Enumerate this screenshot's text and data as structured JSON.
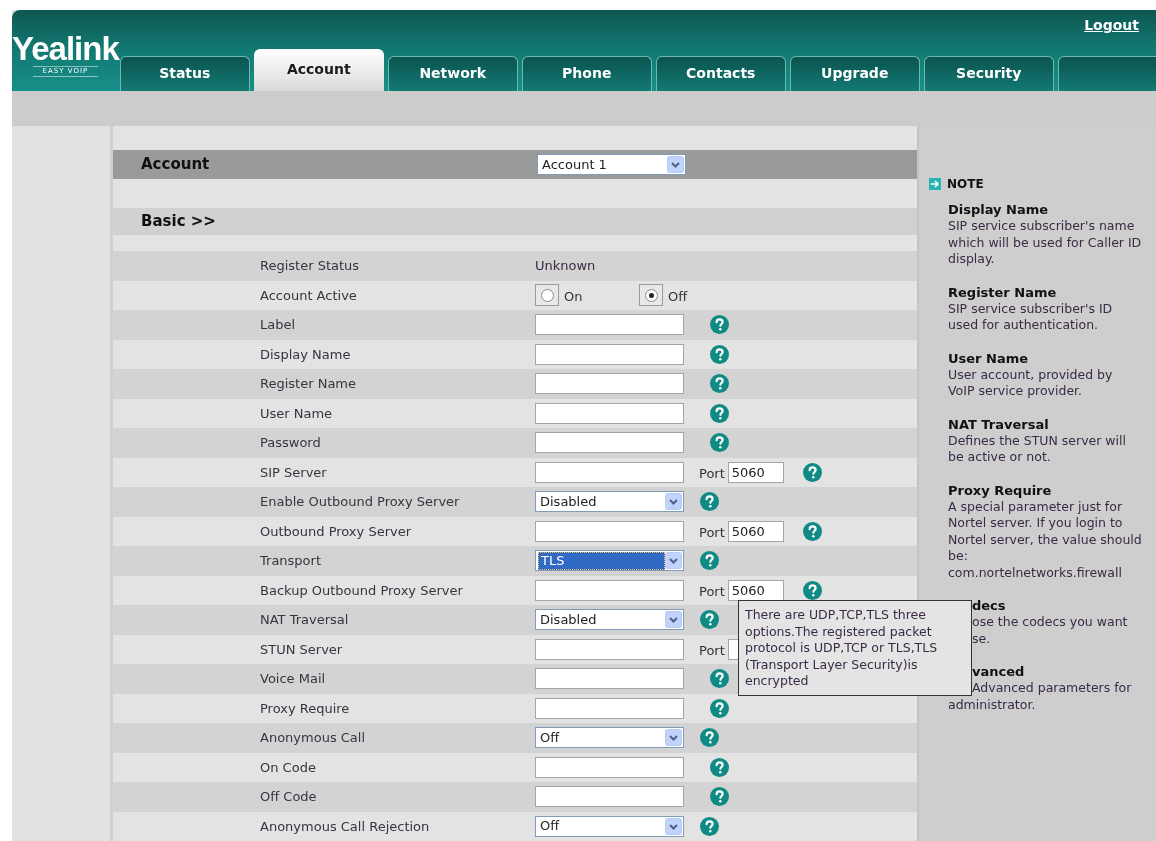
{
  "header": {
    "logo": "Yealink",
    "tagline": "EASY VOIP",
    "logout": "Logout"
  },
  "tabs": [
    {
      "label": "Status",
      "selected": false
    },
    {
      "label": "Account",
      "selected": true
    },
    {
      "label": "Network",
      "selected": false
    },
    {
      "label": "Phone",
      "selected": false
    },
    {
      "label": "Contacts",
      "selected": false
    },
    {
      "label": "Upgrade",
      "selected": false
    },
    {
      "label": "Security",
      "selected": false
    },
    {
      "selected": false
    }
  ],
  "account_bar": {
    "title": "Account",
    "select": "Account 1"
  },
  "section": {
    "title": "Basic >>"
  },
  "rows": [
    {
      "kind": "text",
      "label": "Register Status",
      "value": "Unknown",
      "help": false
    },
    {
      "kind": "radio",
      "label": "Account Active",
      "options": [
        {
          "label": "On",
          "selected": false
        },
        {
          "label": "Off",
          "selected": true
        }
      ],
      "help": false
    },
    {
      "kind": "input",
      "label": "Label",
      "value": "",
      "help": true
    },
    {
      "kind": "input",
      "label": "Display Name",
      "value": "",
      "help": true
    },
    {
      "kind": "input",
      "label": "Register Name",
      "value": "",
      "help": true
    },
    {
      "kind": "input",
      "label": "User Name",
      "value": "",
      "help": true
    },
    {
      "kind": "input",
      "label": "Password",
      "value": "",
      "help": true
    },
    {
      "kind": "port",
      "label": "SIP Server",
      "value": "",
      "port_label": "Port",
      "port": "5060",
      "help": true
    },
    {
      "kind": "select",
      "label": "Enable Outbound Proxy Server",
      "value": "Disabled",
      "highlighted": false,
      "help": true
    },
    {
      "kind": "port",
      "label": "Outbound Proxy Server",
      "value": "",
      "port_label": "Port",
      "port": "5060",
      "help": true
    },
    {
      "kind": "select",
      "label": "Transport",
      "value": "TLS",
      "highlighted": true,
      "help": true
    },
    {
      "kind": "port",
      "label": "Backup Outbound Proxy Server",
      "value": "",
      "port_label": "Port",
      "port": "5060",
      "help": true
    },
    {
      "kind": "select",
      "label": "NAT Traversal",
      "value": "Disabled",
      "highlighted": false,
      "help": true
    },
    {
      "kind": "port",
      "label": "STUN Server",
      "value": "",
      "port_label": "Port",
      "port": "",
      "help": false
    },
    {
      "kind": "input",
      "label": "Voice Mail",
      "value": "",
      "help": true
    },
    {
      "kind": "input",
      "label": "Proxy Require",
      "value": "",
      "help": true
    },
    {
      "kind": "select",
      "label": "Anonymous Call",
      "value": "Off",
      "highlighted": false,
      "help": true
    },
    {
      "kind": "input",
      "label": "On Code",
      "value": "",
      "help": true
    },
    {
      "kind": "input",
      "label": "Off Code",
      "value": "",
      "help": true
    },
    {
      "kind": "select",
      "label": "Anonymous Call Rejection",
      "value": "Off",
      "highlighted": false,
      "help": true
    }
  ],
  "tooltip": "There are UDP,TCP,TLS three options.The registered packet protocol is UDP,TCP or TLS,TLS (Transport Layer Security)is encrypted",
  "note": {
    "title": "NOTE",
    "items": [
      {
        "title": "Display Name",
        "title_cut": false,
        "lines": [
          {
            "text": "SIP service subscriber's name",
            "cut": false
          },
          {
            "text": "which will be used for Caller ID",
            "cut": false
          },
          {
            "text": "display.",
            "cut": false
          }
        ]
      },
      {
        "title": "Register Name",
        "title_cut": false,
        "lines": [
          {
            "text": "SIP service subscriber's ID",
            "cut": false
          },
          {
            "text": "used for authentication.",
            "cut": false
          }
        ]
      },
      {
        "title": "User Name",
        "title_cut": false,
        "lines": [
          {
            "text": "User account, provided by",
            "cut": false
          },
          {
            "text": "VoIP service provider.",
            "cut": false
          }
        ]
      },
      {
        "title": "NAT Traversal",
        "title_cut": false,
        "lines": [
          {
            "text": "Defines the STUN server will",
            "cut": false
          },
          {
            "text": "be active or not.",
            "cut": false
          }
        ]
      },
      {
        "title": "Proxy Require",
        "title_cut": false,
        "lines": [
          {
            "text": "A special parameter just for",
            "cut": false
          },
          {
            "text": "Nortel server. If you login to",
            "cut": false
          },
          {
            "text": "Nortel server, the value should",
            "cut": false
          },
          {
            "text": "be:",
            "cut": false
          },
          {
            "text": "com.nortelnetworks.firewall",
            "cut": false
          }
        ]
      },
      {
        "title": "decs",
        "title_cut": true,
        "lines": [
          {
            "text": "ose the codecs you want",
            "cut": true
          },
          {
            "text": "se.",
            "cut": true
          }
        ]
      },
      {
        "title": "vanced",
        "title_cut": true,
        "lines": [
          {
            "text": "Advanced parameters for",
            "cut": true
          },
          {
            "text": "administrator.",
            "cut": false
          }
        ]
      }
    ]
  }
}
